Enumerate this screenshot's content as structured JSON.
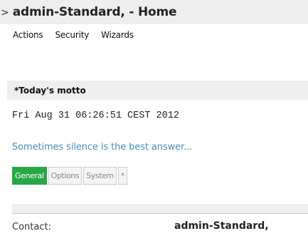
{
  "window": {
    "caret": ">",
    "title": "admin-Standard, - Home"
  },
  "menu": {
    "items": [
      {
        "label": "Actions"
      },
      {
        "label": "Security"
      },
      {
        "label": "Wizards"
      }
    ]
  },
  "motto": {
    "header": "*Today's motto",
    "timestamp": "Fri Aug 31 06:26:51 CEST 2012",
    "text": "Sometimes silence is the best answer..."
  },
  "tabs": [
    {
      "label": "General",
      "active": true
    },
    {
      "label": "Options",
      "active": false
    },
    {
      "label": "System",
      "active": false
    },
    {
      "label": "*",
      "active": false
    }
  ],
  "general": {
    "contact_label": "Contact:",
    "contact_value": "admin-Standard,"
  },
  "colors": {
    "active_tab": "#28a745",
    "motto_text": "#4a8bb5",
    "header_bg": "#eeeeee"
  }
}
